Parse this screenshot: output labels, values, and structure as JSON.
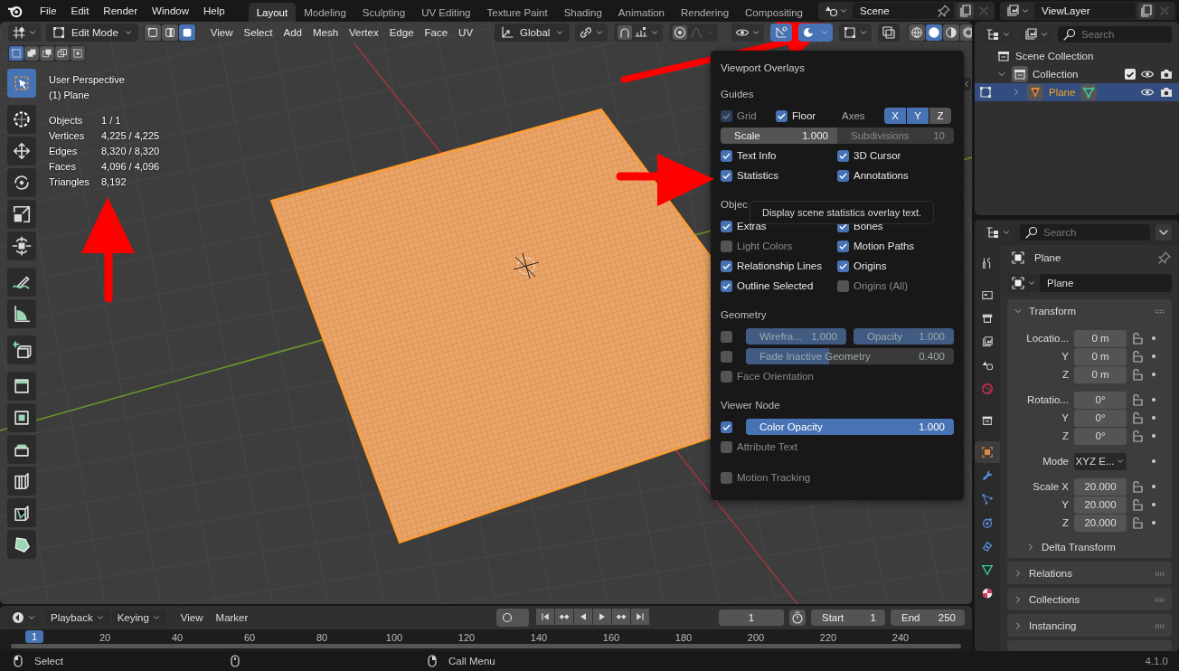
{
  "top_menu": [
    "File",
    "Edit",
    "Render",
    "Window",
    "Help"
  ],
  "workspaces": [
    {
      "label": "Layout",
      "selected": true
    },
    {
      "label": "Modeling",
      "selected": false
    },
    {
      "label": "Sculpting",
      "selected": false
    },
    {
      "label": "UV Editing",
      "selected": false
    },
    {
      "label": "Texture Paint",
      "selected": false
    },
    {
      "label": "Shading",
      "selected": false
    },
    {
      "label": "Animation",
      "selected": false
    },
    {
      "label": "Rendering",
      "selected": false
    },
    {
      "label": "Compositing",
      "selected": false
    }
  ],
  "scene": {
    "name": "Scene"
  },
  "view_layer": {
    "name": "ViewLayer"
  },
  "viewport_header": {
    "mode": "Edit Mode",
    "select_modes": [
      {
        "selected": false
      },
      {
        "selected": false
      },
      {
        "selected": true
      }
    ],
    "menus": [
      "View",
      "Select",
      "Add",
      "Mesh",
      "Vertex",
      "Edge",
      "Face",
      "UV"
    ],
    "orientation": "Global",
    "gizmos_on": true,
    "overlays_on": true,
    "shading": [
      {
        "selected": false
      },
      {
        "selected": true
      },
      {
        "selected": false
      },
      {
        "selected": false
      }
    ]
  },
  "box_modes": [
    {
      "selected": true
    },
    {
      "selected": false
    },
    {
      "selected": false
    },
    {
      "selected": false
    },
    {
      "selected": false
    }
  ],
  "tools": [
    {
      "selected": true
    },
    {
      "selected": false
    },
    {
      "selected": false
    },
    {
      "selected": false
    },
    {
      "selected": false
    },
    {
      "selected": false
    },
    {
      "selected": false
    },
    {
      "selected": false
    },
    {
      "selected": false
    },
    {
      "selected": false
    },
    {
      "selected": false
    },
    {
      "selected": false
    },
    {
      "selected": false
    },
    {
      "selected": false
    },
    {
      "selected": false
    }
  ],
  "overlay_info": {
    "view": "User Perspective",
    "object": "(1) Plane",
    "stats": [
      {
        "label": "Objects",
        "value": "1 / 1"
      },
      {
        "label": "Vertices",
        "value": "4,225 / 4,225"
      },
      {
        "label": "Edges",
        "value": "8,320 / 8,320"
      },
      {
        "label": "Faces",
        "value": "4,096 / 4,096"
      },
      {
        "label": "Triangles",
        "value": "8,192"
      }
    ]
  },
  "overlays_popup": {
    "title": "Viewport Overlays",
    "sections": [
      {
        "title": "Guides",
        "rows": [
          {
            "kind": "guides",
            "items": [
              {
                "label": "Grid",
                "checked": true,
                "disabled": true
              },
              {
                "label": "Floor",
                "checked": true,
                "disabled": false
              }
            ],
            "axes": {
              "label": "Axes",
              "toggles": [
                {
                  "label": "X",
                  "on": true
                },
                {
                  "label": "Y",
                  "on": true
                },
                {
                  "label": "Z",
                  "on": false
                }
              ]
            }
          },
          {
            "kind": "fields",
            "fields": [
              {
                "label": "Scale",
                "value": "1.000",
                "disabled": false
              },
              {
                "label": "Subdivisions",
                "value": "10",
                "disabled": true
              }
            ]
          },
          {
            "kind": "checks",
            "items": [
              {
                "label": "Text Info",
                "checked": true
              },
              {
                "label": "3D Cursor",
                "checked": true
              }
            ]
          },
          {
            "kind": "checks",
            "items": [
              {
                "label": "Statistics",
                "checked": true
              },
              {
                "label": "Annotations",
                "checked": true
              }
            ]
          }
        ]
      },
      {
        "title": "Objec",
        "rows": [
          {
            "kind": "checks",
            "items": [
              {
                "label": "Extras",
                "checked": true
              },
              {
                "label": "Bones",
                "checked": true
              }
            ]
          },
          {
            "kind": "checks",
            "items": [
              {
                "label": "Light Colors",
                "checked": false
              },
              {
                "label": "Motion Paths",
                "checked": true
              }
            ]
          },
          {
            "kind": "checks",
            "items": [
              {
                "label": "Relationship Lines",
                "checked": true
              },
              {
                "label": "Origins",
                "checked": true
              }
            ]
          },
          {
            "kind": "checks",
            "items": [
              {
                "label": "Outline Selected",
                "checked": true
              },
              {
                "label": "Origins (All)",
                "checked": false
              }
            ]
          }
        ]
      },
      {
        "title": "Geometry",
        "rows": [
          {
            "kind": "sliders",
            "checked": false,
            "sliders": [
              {
                "label": "Wirefra...",
                "value": "1.000",
                "level": 1,
                "disabled": true
              },
              {
                "label": "Opacity",
                "value": "1.000",
                "level": 1,
                "disabled": true
              }
            ]
          },
          {
            "kind": "sliders",
            "checked": false,
            "sliders": [
              {
                "label": "Fade Inactive Geometry",
                "value": "0.400",
                "level": 0.4,
                "disabled": true
              }
            ]
          },
          {
            "kind": "checks",
            "items": [
              {
                "label": "Face Orientation",
                "checked": false
              }
            ]
          }
        ]
      },
      {
        "title": "Viewer Node",
        "rows": [
          {
            "kind": "sliders",
            "checked": true,
            "sliders": [
              {
                "label": "Color Opacity",
                "value": "1.000",
                "level": 1,
                "disabled": false
              }
            ]
          },
          {
            "kind": "checks",
            "items": [
              {
                "label": "Attribute Text",
                "checked": false
              }
            ]
          }
        ]
      },
      {
        "rows": [
          {
            "kind": "checks",
            "items": [
              {
                "label": "Motion Tracking",
                "checked": false
              }
            ]
          }
        ]
      }
    ]
  },
  "tooltip": {
    "text": "Display scene statistics overlay text."
  },
  "outliner": {
    "search_placeholder": "Search",
    "tree": [
      {
        "label": "Scene Collection",
        "children": [
          {
            "label": "Collection",
            "expanded": true,
            "checked": true,
            "children": [
              {
                "label": "Plane",
                "selected": true,
                "expanded": false
              }
            ]
          }
        ]
      }
    ]
  },
  "properties": {
    "search_placeholder": "Search",
    "tabs": [
      {
        "selected": false
      },
      {
        "selected": false
      },
      {
        "selected": false
      },
      {
        "selected": false
      },
      {
        "selected": false
      },
      {
        "selected": false
      },
      {
        "selected": false
      },
      {
        "selected": true
      },
      {
        "selected": false
      },
      {
        "selected": false
      },
      {
        "selected": false
      },
      {
        "selected": false
      },
      {
        "selected": false
      },
      {
        "selected": false
      }
    ],
    "object_name": "Plane",
    "data_name": "Plane",
    "panels": [
      {
        "title": "Transform",
        "expanded": true,
        "groups": [
          [
            {
              "kind": "number",
              "label": "Locatio...",
              "value": "0 m"
            },
            {
              "kind": "number",
              "label": "Y",
              "value": "0 m"
            },
            {
              "kind": "number",
              "label": "Z",
              "value": "0 m"
            }
          ],
          [
            {
              "kind": "number",
              "label": "Rotatio...",
              "value": "0°"
            },
            {
              "kind": "number",
              "label": "Y",
              "value": "0°"
            },
            {
              "kind": "number",
              "label": "Z",
              "value": "0°"
            }
          ],
          [
            {
              "kind": "dropdown",
              "label": "Mode",
              "value": "XYZ E..."
            }
          ],
          [
            {
              "kind": "number",
              "label": "Scale X",
              "value": "20.000"
            },
            {
              "kind": "number",
              "label": "Y",
              "value": "20.000"
            },
            {
              "kind": "number",
              "label": "Z",
              "value": "20.000"
            }
          ]
        ],
        "subpanels": [
          {
            "title": "Delta Transform",
            "expanded": false
          }
        ]
      },
      {
        "title": "Relations",
        "expanded": false
      },
      {
        "title": "Collections",
        "expanded": false
      },
      {
        "title": "Instancing",
        "expanded": false
      }
    ]
  },
  "timeline": {
    "menus": [
      {
        "label": "Playback",
        "dropdown": true
      },
      {
        "label": "Keying",
        "dropdown": true
      },
      {
        "label": "View",
        "dropdown": false
      },
      {
        "label": "Marker",
        "dropdown": false
      }
    ],
    "current_frame": "1",
    "start": {
      "label": "Start",
      "value": "1"
    },
    "end": {
      "label": "End",
      "value": "250"
    },
    "ticks": [
      "20",
      "40",
      "60",
      "80",
      "100",
      "120",
      "140",
      "160",
      "180",
      "200",
      "220",
      "240"
    ],
    "playhead": "1"
  },
  "status_bar": {
    "items": [
      {
        "label": "Select"
      },
      {
        "label": "Call Menu"
      }
    ],
    "version": "4.1.0"
  }
}
